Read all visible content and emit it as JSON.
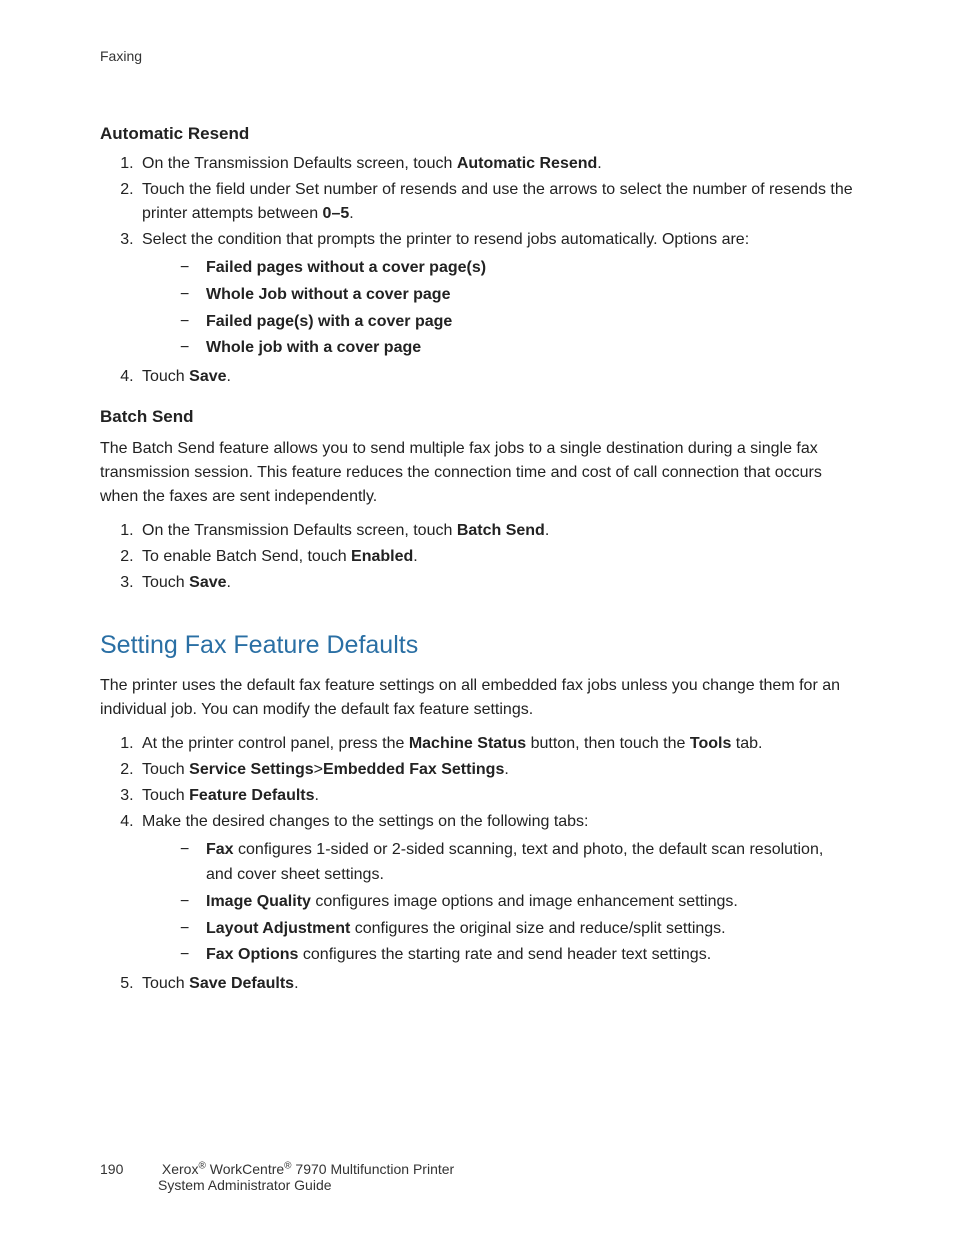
{
  "header": {
    "section": "Faxing"
  },
  "automaticResend": {
    "heading": "Automatic Resend",
    "step1_pre": "On the Transmission Defaults screen, touch ",
    "step1_bold": "Automatic Resend",
    "step1_post": ".",
    "step2_pre": "Touch the field under Set number of resends and use the arrows to select the number of resends the printer attempts between ",
    "step2_bold": "0–5",
    "step2_post": ".",
    "step3": "Select the condition that prompts the printer to resend jobs automatically. Options are:",
    "opt1": "Failed pages without a cover page(s)",
    "opt2": "Whole Job without a cover page",
    "opt3": "Failed page(s) with a cover page",
    "opt4": "Whole job with a cover page",
    "step4_pre": "Touch ",
    "step4_bold": "Save",
    "step4_post": "."
  },
  "batchSend": {
    "heading": "Batch Send",
    "intro": "The Batch Send feature allows you to send multiple fax jobs to a single destination during a single fax transmission session. This feature reduces the connection time and cost of call connection that occurs when the faxes are sent independently.",
    "step1_pre": "On the Transmission Defaults screen, touch ",
    "step1_bold": "Batch Send",
    "step1_post": ".",
    "step2_pre": "To enable Batch Send, touch ",
    "step2_bold": "Enabled",
    "step2_post": ".",
    "step3_pre": "Touch ",
    "step3_bold": "Save",
    "step3_post": "."
  },
  "faxDefaults": {
    "heading": "Setting Fax Feature Defaults",
    "intro": "The printer uses the default fax feature settings on all embedded fax jobs unless you change them for an individual job. You can modify the default fax feature settings.",
    "step1_a": "At the printer control panel, press the ",
    "step1_b": "Machine Status",
    "step1_c": " button, then touch the ",
    "step1_d": "Tools",
    "step1_e": " tab.",
    "step2_a": "Touch ",
    "step2_b": "Service Settings",
    "step2_c": ">",
    "step2_d": "Embedded Fax Settings",
    "step2_e": ".",
    "step3_a": "Touch ",
    "step3_b": "Feature Defaults",
    "step3_c": ".",
    "step4": "Make the desired changes to the settings on the following tabs:",
    "sub1_b": "Fax",
    "sub1_t": " configures 1-sided or 2-sided scanning, text and photo, the default scan resolution, and cover sheet settings.",
    "sub2_b": "Image Quality",
    "sub2_t": " configures image options and image enhancement settings.",
    "sub3_b": "Layout Adjustment",
    "sub3_t": " configures the original size and reduce/split settings.",
    "sub4_b": "Fax Options",
    "sub4_t": " configures the starting rate and send header text settings.",
    "step5_a": "Touch ",
    "step5_b": "Save Defaults",
    "step5_c": "."
  },
  "footer": {
    "pageNum": "190",
    "brand1": "Xerox",
    "brand2": " WorkCentre",
    "model": " 7970 Multifunction Printer",
    "line2": "System Administrator Guide"
  }
}
